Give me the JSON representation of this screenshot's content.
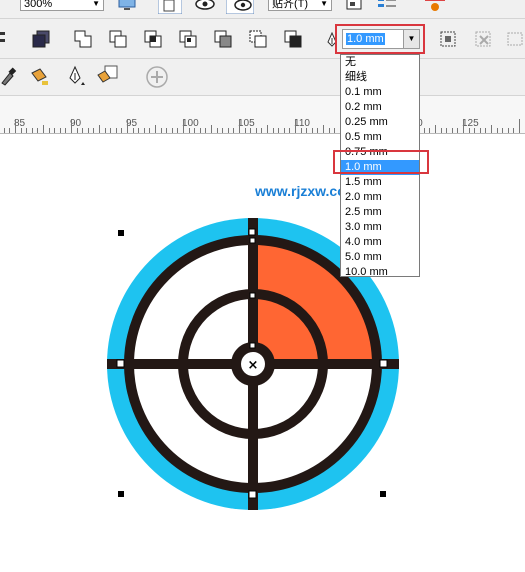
{
  "top_bar": {
    "zoom_value": "300%",
    "snap_label": "贴齐(T)"
  },
  "outline_width": {
    "value": "1.0 mm",
    "options": [
      "无",
      "细线",
      "0.1 mm",
      "0.2 mm",
      "0.25 mm",
      "0.5 mm",
      "0.75 mm",
      "1.0 mm",
      "1.5 mm",
      "2.0 mm",
      "2.5 mm",
      "3.0 mm",
      "4.0 mm",
      "5.0 mm",
      "10.0 mm"
    ],
    "selected_index": 7
  },
  "ruler": {
    "labels": [
      "85",
      "90",
      "95",
      "100",
      "105",
      "110",
      "115",
      "120",
      "125"
    ]
  },
  "watermark": "www.rjzxw.com",
  "colors": {
    "ring_outer": "#1ec3f0",
    "quadrant_fill": "#ff6633",
    "stroke": "#231815",
    "highlight_red": "#d9363e",
    "selection_blue": "#3399ff"
  }
}
